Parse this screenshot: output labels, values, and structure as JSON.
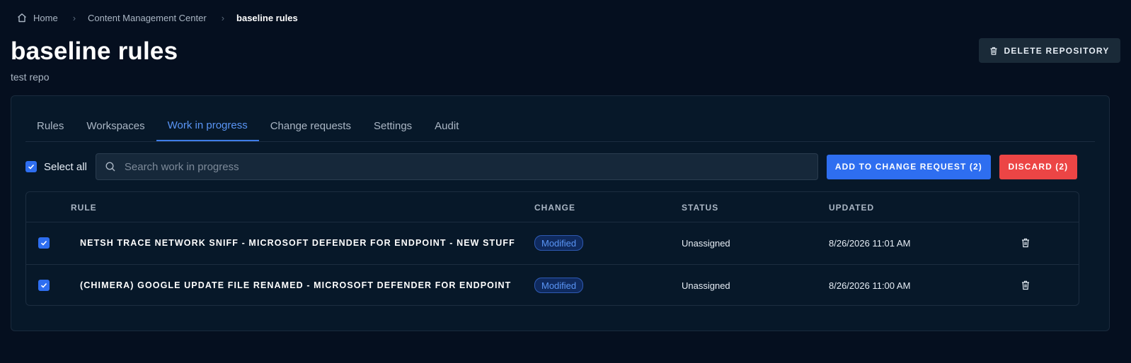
{
  "breadcrumb": {
    "home": "Home",
    "section": "Content Management Center",
    "current": "baseline rules",
    "separator": "›"
  },
  "page": {
    "title": "baseline rules",
    "subtitle": "test repo",
    "delete_button": "DELETE REPOSITORY"
  },
  "tabs": [
    {
      "label": "Rules",
      "active": false
    },
    {
      "label": "Workspaces",
      "active": false
    },
    {
      "label": "Work in progress",
      "active": true
    },
    {
      "label": "Change requests",
      "active": false
    },
    {
      "label": "Settings",
      "active": false
    },
    {
      "label": "Audit",
      "active": false
    }
  ],
  "toolbar": {
    "select_all_label": "Select all",
    "select_all_checked": true,
    "search_placeholder": "Search work in progress",
    "add_button": "ADD TO CHANGE REQUEST (2)",
    "discard_button": "DISCARD (2)"
  },
  "table": {
    "headers": {
      "rule": "RULE",
      "change": "CHANGE",
      "status": "STATUS",
      "updated": "UPDATED"
    },
    "rows": [
      {
        "checked": true,
        "rule": "NETSH TRACE NETWORK SNIFF - MICROSOFT DEFENDER FOR ENDPOINT - NEW STUFF",
        "change": "Modified",
        "status": "Unassigned",
        "updated": "8/26/2026 11:01 AM"
      },
      {
        "checked": true,
        "rule": "(CHIMERA) GOOGLE UPDATE FILE RENAMED - MICROSOFT DEFENDER FOR ENDPOINT",
        "change": "Modified",
        "status": "Unassigned",
        "updated": "8/26/2026 11:00 AM"
      }
    ]
  },
  "colors": {
    "background": "#050f1f",
    "panel": "#071829",
    "accent": "#2e6ef0",
    "active_tab": "#5a95f5",
    "danger": "#ec4545"
  },
  "icons": [
    "home-icon",
    "chevron-right-icon",
    "trash-icon",
    "search-icon",
    "checkmark-icon"
  ]
}
